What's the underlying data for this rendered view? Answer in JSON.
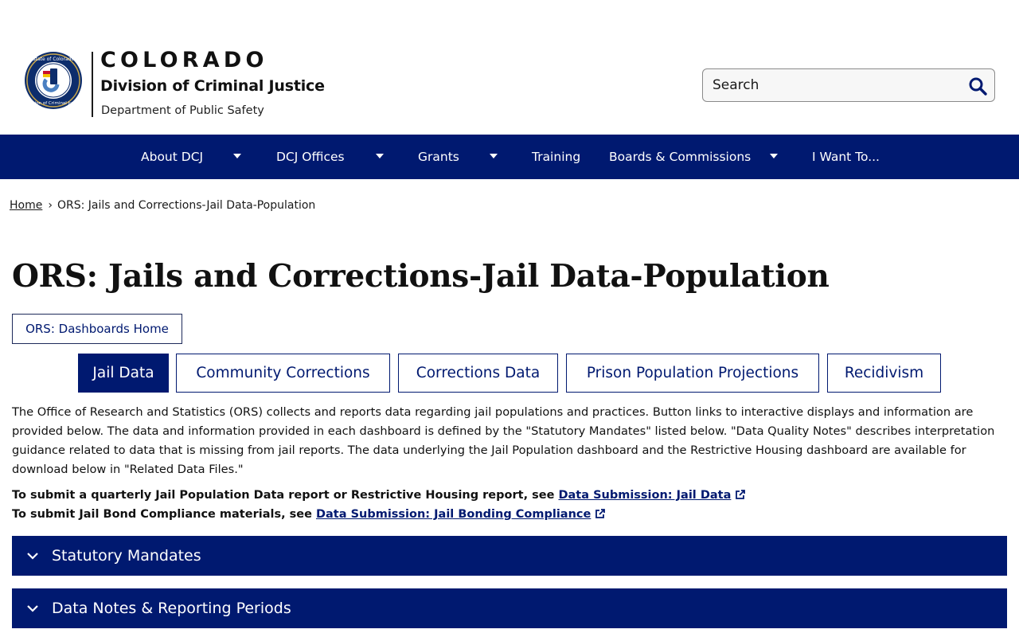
{
  "brand": {
    "state": "COLORADO",
    "division": "Division of Criminal Justice",
    "department": "Department of Public Safety",
    "seal_alt": "State of Colorado Division of Criminal Justice seal"
  },
  "search": {
    "placeholder": "Search"
  },
  "nav": {
    "items": [
      {
        "label": "About DCJ",
        "has_dropdown": true
      },
      {
        "label": "DCJ Offices",
        "has_dropdown": true
      },
      {
        "label": "Grants",
        "has_dropdown": true
      },
      {
        "label": "Training",
        "has_dropdown": false
      },
      {
        "label": "Boards & Commissions",
        "has_dropdown": true
      },
      {
        "label": "I Want To...",
        "has_dropdown": false
      }
    ]
  },
  "breadcrumb": {
    "home": "Home",
    "separator": "›",
    "current": "ORS: Jails and Corrections-Jail Data-Population"
  },
  "page": {
    "title": "ORS: Jails and Corrections-Jail Data-Population",
    "home_button": "ORS: Dashboards Home"
  },
  "tabs": [
    {
      "label": "Jail Data",
      "active": true
    },
    {
      "label": "Community Corrections",
      "active": false
    },
    {
      "label": "Corrections Data",
      "active": false
    },
    {
      "label": "Prison Population Projections",
      "active": false
    },
    {
      "label": "Recidivism",
      "active": false
    }
  ],
  "intro": "The Office of Research and Statistics (ORS) collects and reports data regarding jail populations and practices. Button links to interactive displays and information are provided below. The data and information provided in each dashboard is defined by the \"Statutory Mandates\" listed below. \"Data Quality Notes\" describes interpretation guidance related to data that is missing from jail reports. The data underlying the Jail Population dashboard and the Restrictive Housing dashboard are available for download below in \"Related Data Files.\"",
  "submit": {
    "line1_text": "To submit a quarterly Jail Population Data report or Restrictive Housing report, see ",
    "line1_link": "Data Submission: Jail Data",
    "line2_text": "To submit Jail Bond Compliance materials, see ",
    "line2_link": "Data Submission: Jail Bonding Compliance"
  },
  "accordions": [
    {
      "label": "Statutory Mandates"
    },
    {
      "label": "Data Notes & Reporting Periods"
    }
  ],
  "colors": {
    "primary_navy": "#001970",
    "white": "#ffffff",
    "seal_gold": "#c8a64b",
    "seal_blue": "#0d2d6c"
  }
}
